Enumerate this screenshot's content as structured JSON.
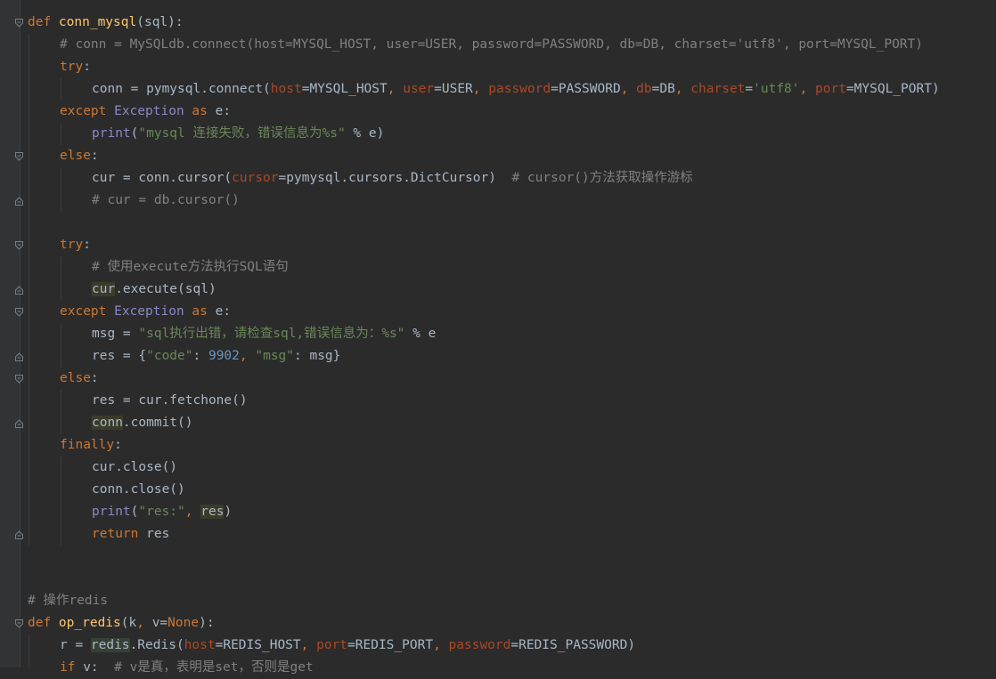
{
  "colors": {
    "background": "#2b2b2b",
    "keyword": "#cc7832",
    "function": "#ffc66d",
    "string": "#6a8759",
    "number": "#6897bb",
    "comment": "#808080",
    "param": "#aa4926",
    "builtin": "#8888c6",
    "text": "#a9b7c6"
  },
  "code": {
    "l1": {
      "kw": "def ",
      "fn": "conn_mysql",
      "rest": "(sql):"
    },
    "l2": {
      "comment": "# conn = MySQLdb.connect(host=MYSQL_HOST, user=USER, password=PASSWORD, db=DB, charset='utf8', port=MYSQL_PORT)"
    },
    "l3": {
      "kw": "try",
      "rest": ":"
    },
    "l4": {
      "a": "conn = pymysql.connect(",
      "p1": "host",
      "b": "=MYSQL_HOST",
      "c1": ", ",
      "p2": "user",
      "d": "=USER",
      "c2": ", ",
      "p3": "password",
      "e": "=PASSWORD",
      "c3": ", ",
      "p4": "db",
      "f": "=DB",
      "c4": ", ",
      "p5": "charset",
      "g": "=",
      "s": "'utf8'",
      "c5": ", ",
      "p6": "port",
      "h": "=MYSQL_PORT)"
    },
    "l5": {
      "kw1": "except ",
      "bi": "Exception",
      "kw2": " as ",
      "rest": "e:"
    },
    "l6": {
      "bi": "print",
      "a": "(",
      "str": "\"mysql 连接失败，错误信息为%s\"",
      "rest": " % e)"
    },
    "l7": {
      "kw": "else",
      "rest": ":"
    },
    "l8": {
      "a": "cur = conn.cursor(",
      "p": "cursor",
      "b": "=pymysql.cursors.DictCursor)  ",
      "comment": "# cursor()方法获取操作游标"
    },
    "l9": {
      "comment": "# cur = db.cursor()"
    },
    "l11": {
      "kw": "try",
      "rest": ":"
    },
    "l12": {
      "comment": "# 使用execute方法执行SQL语句"
    },
    "l13": {
      "hl": "cur",
      "rest": ".execute(sql)"
    },
    "l14": {
      "kw1": "except ",
      "bi": "Exception",
      "kw2": " as ",
      "rest": "e:"
    },
    "l15": {
      "a": "msg = ",
      "str": "\"sql执行出错，请检查sql,错误信息为：%s\"",
      "rest": " % e"
    },
    "l16": {
      "a": "res = {",
      "s1": "\"code\"",
      "b": ": ",
      "n": "9902",
      "c": ", ",
      "s2": "\"msg\"",
      "d": ": msg}"
    },
    "l17": {
      "kw": "else",
      "rest": ":"
    },
    "l18": {
      "a": "res = cur.fetchone()"
    },
    "l19": {
      "hl": "conn",
      "rest": ".commit()"
    },
    "l20": {
      "kw": "finally",
      "rest": ":"
    },
    "l21": {
      "a": "cur.close()"
    },
    "l22": {
      "a": "conn.close()"
    },
    "l23": {
      "bi": "print",
      "a": "(",
      "str": "\"res:\"",
      "b": ", ",
      "hl": "res",
      "rest": ")"
    },
    "l24": {
      "kw": "return",
      "rest": " res"
    },
    "l27": {
      "comment": "# 操作redis"
    },
    "l28": {
      "kw": "def ",
      "fn": "op_redis",
      "a": "(k",
      "c": ", ",
      "b": "v=",
      "kw2": "None",
      "rest": "):"
    },
    "l29": {
      "a": "r = ",
      "hl": "redis",
      "b": ".Redis(",
      "p1": "host",
      "c": "=REDIS_HOST",
      "c1": ", ",
      "p2": "port",
      "d": "=REDIS_PORT",
      "c2": ", ",
      "p3": "password",
      "e": "=REDIS_PASSWORD)"
    },
    "l30": {
      "kw": "if",
      "a": " v:  ",
      "comment": "# v是真，表明是set，否则是get"
    }
  }
}
